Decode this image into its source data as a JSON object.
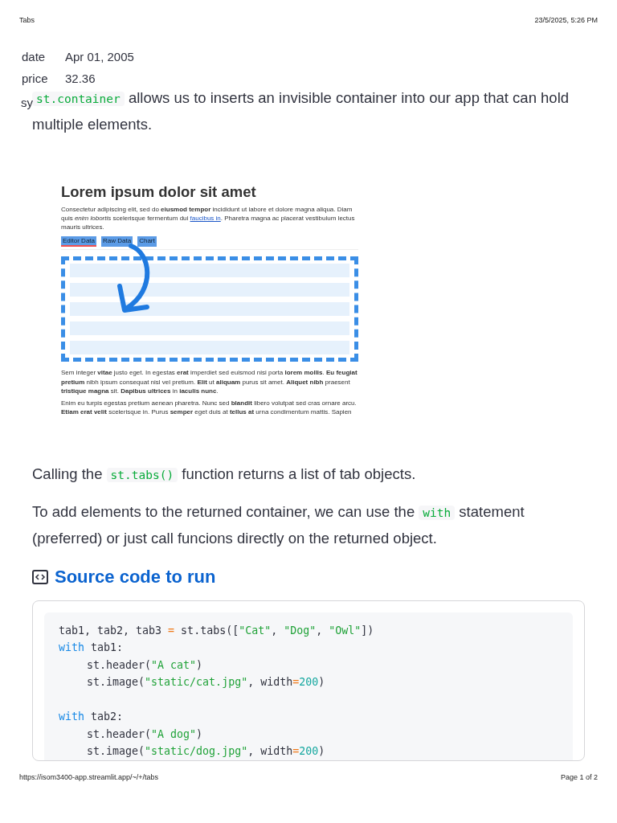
{
  "print_header": {
    "title": "Tabs",
    "datetime": "23/5/2025, 5:26 PM"
  },
  "fields": [
    {
      "label": "date",
      "value": "Apr 01, 2005"
    },
    {
      "label": "price",
      "value": "32.36"
    }
  ],
  "fragment": "sy",
  "intro": [
    {
      "kind": "code",
      "text": "st.container"
    },
    {
      "kind": "text",
      "text": " allows us to inserts an invisible container into our app that can hold multiple elements."
    }
  ],
  "screenshot": {
    "heading": "Lorem ipsum dolor sit amet",
    "paragraph_1": [
      {
        "kind": "text",
        "text": "Consectetur adipiscing elit, sed do **eiusmod tempor** incididunt ut labore et dolore magna aliqua. Diam quis *enim lobortis* scelerisque fermentum dui "
      },
      {
        "kind": "link",
        "text": "faucibus in"
      },
      {
        "kind": "text",
        "text": ". Pharetra magna ac placerat vestibulum lectus mauris ultrices."
      }
    ],
    "tabs": [
      {
        "label": "Editor Data",
        "selected": true
      },
      {
        "label": "Raw Data",
        "selected": false
      },
      {
        "label": "Chart",
        "selected": false
      }
    ],
    "paragraphs": [
      "Sem integer **vitae** justo eget. In egestas **erat** imperdiet sed euismod nisi porta **lorem mollis**. **Eu feugiat pretium** nibh ipsum consequat nisl vel pretium. **Elit** ut **aliquam** purus sit amet. **Aliquet nibh** praesent **tristique magna** sit. **Dapibus ultrices** in **iaculis nunc**.",
      "Enim eu turpis egestas pretium aenean pharetra. Nunc sed **blandit** libero volutpat sed cras ornare arcu. **Etiam erat velit** scelerisque in. Purus **semper** eget duis at **tellus at** urna condimentum mattis. Sapien"
    ]
  },
  "calling": [
    {
      "kind": "text",
      "text": "Calling the "
    },
    {
      "kind": "code",
      "text": "st.tabs()"
    },
    {
      "kind": "text",
      "text": " function returns a list of tab objects."
    }
  ],
  "add_elements": [
    {
      "kind": "text",
      "text": "To add elements to the returned container, we can use the "
    },
    {
      "kind": "code",
      "text": "with"
    },
    {
      "kind": "text",
      "text": " statement (preferred) or just call funcions directly on the returned object."
    }
  ],
  "section_title": "Source code to run",
  "code_blocks": [
    [
      {
        "tokens": [
          {
            "kind": "plain",
            "text": "tab1, tab2, tab3 "
          },
          {
            "kind": "op",
            "text": "="
          },
          {
            "kind": "plain",
            "text": " st.tabs(["
          },
          {
            "kind": "str",
            "text": "\"Cat\""
          },
          {
            "kind": "plain",
            "text": ", "
          },
          {
            "kind": "str",
            "text": "\"Dog\""
          },
          {
            "kind": "plain",
            "text": ", "
          },
          {
            "kind": "str",
            "text": "\"Owl\""
          },
          {
            "kind": "plain",
            "text": "])"
          }
        ]
      },
      {
        "tokens": [
          {
            "kind": "kw",
            "text": "with"
          },
          {
            "kind": "plain",
            "text": " tab1:"
          }
        ],
        "children": [
          {
            "tokens": [
              {
                "kind": "plain",
                "text": "st.header("
              },
              {
                "kind": "str",
                "text": "\"A cat\""
              },
              {
                "kind": "plain",
                "text": ")"
              }
            ]
          },
          {
            "tokens": [
              {
                "kind": "plain",
                "text": "st.image("
              },
              {
                "kind": "str",
                "text": "\"static/cat.jpg\""
              },
              {
                "kind": "plain",
                "text": ", width"
              },
              {
                "kind": "op",
                "text": "="
              },
              {
                "kind": "num",
                "text": "200"
              },
              {
                "kind": "plain",
                "text": ")"
              }
            ]
          }
        ]
      }
    ],
    [
      {
        "tokens": [
          {
            "kind": "kw",
            "text": "with"
          },
          {
            "kind": "plain",
            "text": " tab2:"
          }
        ],
        "children": [
          {
            "tokens": [
              {
                "kind": "plain",
                "text": "st.header("
              },
              {
                "kind": "str",
                "text": "\"A dog\""
              },
              {
                "kind": "plain",
                "text": ")"
              }
            ]
          },
          {
            "tokens": [
              {
                "kind": "plain",
                "text": "st.image("
              },
              {
                "kind": "str",
                "text": "\"static/dog.jpg\""
              },
              {
                "kind": "plain",
                "text": ", width"
              },
              {
                "kind": "op",
                "text": "="
              },
              {
                "kind": "num",
                "text": "200"
              },
              {
                "kind": "plain",
                "text": ")"
              }
            ]
          }
        ]
      }
    ]
  ],
  "print_footer": {
    "url": "https://isom3400-app.streamlit.app/~/+/tabs",
    "page": "Page 1 of 2"
  }
}
